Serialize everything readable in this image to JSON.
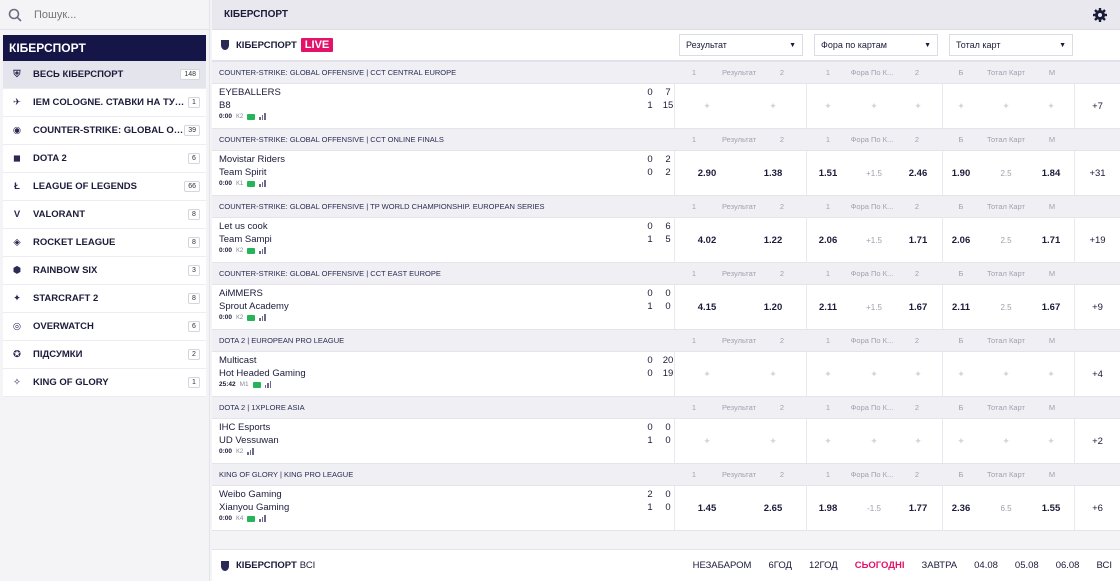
{
  "search": {
    "placeholder": "Пошук..."
  },
  "sidebar": {
    "title": "КІБЕРСПОРТ",
    "items": [
      {
        "label": "ВЕСЬ КІБЕРСПОРТ",
        "count": "148",
        "icon": "esports-icon"
      },
      {
        "label": "IEM COLOGNE. СТАВКИ НА ТУРНІР",
        "count": "1",
        "icon": "iem-icon"
      },
      {
        "label": "COUNTER-STRIKE: GLOBAL OFFENSIVE",
        "count": "39",
        "icon": "csgo-icon"
      },
      {
        "label": "DOTA 2",
        "count": "6",
        "icon": "dota-icon"
      },
      {
        "label": "LEAGUE OF LEGENDS",
        "count": "66",
        "icon": "lol-icon"
      },
      {
        "label": "VALORANT",
        "count": "8",
        "icon": "valorant-icon"
      },
      {
        "label": "ROCKET LEAGUE",
        "count": "8",
        "icon": "rocket-league-icon"
      },
      {
        "label": "RAINBOW SIX",
        "count": "3",
        "icon": "rainbow-six-icon"
      },
      {
        "label": "STARCRAFT 2",
        "count": "8",
        "icon": "starcraft-icon"
      },
      {
        "label": "OVERWATCH",
        "count": "6",
        "icon": "overwatch-icon"
      },
      {
        "label": "ПІДСУМКИ",
        "count": "2",
        "icon": "summary-icon"
      },
      {
        "label": "KING OF GLORY",
        "count": "1",
        "icon": "king-of-glory-icon"
      }
    ]
  },
  "header": {
    "title": "КІБЕРСПОРТ"
  },
  "live": {
    "title": "КІБЕРСПОРТ",
    "badge": "LIVE",
    "dropdowns": [
      "Результат",
      "Фора по картам",
      "Тотал карт"
    ]
  },
  "columns": [
    "1",
    "Результат",
    "2",
    "1",
    "Фора По К...",
    "2",
    "Б",
    "Тотал Карт",
    "М"
  ],
  "leagues": [
    {
      "name": "COUNTER-STRIKE: GLOBAL OFFENSIVE | CCT CENTRAL EUROPE",
      "matches": [
        {
          "team1": "EYEBALLERS",
          "team2": "B8",
          "s1a": "0",
          "s1b": "7",
          "s2a": "1",
          "s2b": "15",
          "time": "0:00",
          "period": "К2",
          "timeBold": true,
          "locked": true,
          "odds": [],
          "more": "+7"
        }
      ]
    },
    {
      "name": "COUNTER-STRIKE: GLOBAL OFFENSIVE | CCT ONLINE FINALS",
      "matches": [
        {
          "team1": "Movistar Riders",
          "team2": "Team Spirit",
          "s1a": "0",
          "s1b": "2",
          "s2a": "0",
          "s2b": "2",
          "time": "0:00",
          "period": "К1",
          "locked": false,
          "odds": [
            "2.90",
            "1.38",
            "1.51",
            "+1.5",
            "2.46",
            "1.90",
            "2.5",
            "1.84"
          ],
          "more": "+31"
        }
      ]
    },
    {
      "name": "COUNTER-STRIKE: GLOBAL OFFENSIVE | TP WORLD CHAMPIONSHIP. EUROPEAN SERIES",
      "matches": [
        {
          "team1": "Let us cook",
          "team2": "Team Sampi",
          "s1a": "0",
          "s1b": "6",
          "s2a": "1",
          "s2b": "5",
          "time": "0:00",
          "period": "К2",
          "locked": false,
          "odds": [
            "4.02",
            "1.22",
            "2.06",
            "+1.5",
            "1.71",
            "2.06",
            "2.5",
            "1.71"
          ],
          "more": "+19"
        }
      ]
    },
    {
      "name": "COUNTER-STRIKE: GLOBAL OFFENSIVE | CCT EAST EUROPE",
      "matches": [
        {
          "team1": "AiMMERS",
          "team2": "Sprout Academy",
          "s1a": "0",
          "s1b": "0",
          "s2a": "1",
          "s2b": "0",
          "time": "0:00",
          "period": "К2",
          "locked": false,
          "odds": [
            "4.15",
            "1.20",
            "2.11",
            "+1.5",
            "1.67",
            "2.11",
            "2.5",
            "1.67"
          ],
          "more": "+9"
        }
      ]
    },
    {
      "name": "DOTA 2 | EUROPEAN PRO LEAGUE",
      "matches": [
        {
          "team1": "Multicast",
          "team2": "Hot Headed Gaming",
          "s1a": "0",
          "s1b": "20",
          "s2a": "0",
          "s2b": "19",
          "time": "25:42",
          "period": "М1",
          "locked": true,
          "odds": [],
          "more": "+4"
        }
      ]
    },
    {
      "name": "DOTA 2 | 1XPLORE ASIA",
      "matches": [
        {
          "team1": "IHC Esports",
          "team2": "UD Vessuwan",
          "s1a": "0",
          "s1b": "0",
          "s2a": "1",
          "s2b": "0",
          "time": "0:00",
          "period": "К2",
          "locked": true,
          "noTv": true,
          "odds": [],
          "more": "+2"
        }
      ]
    },
    {
      "name": "KING OF GLORY | KING PRO LEAGUE",
      "matches": [
        {
          "team1": "Weibo Gaming",
          "team2": "Xianyou Gaming",
          "s1a": "2",
          "s1b": "0",
          "s2a": "1",
          "s2b": "0",
          "time": "0:00",
          "period": "К4",
          "locked": false,
          "odds": [
            "1.45",
            "2.65",
            "1.98",
            "-1.5",
            "1.77",
            "2.36",
            "6.5",
            "1.55"
          ],
          "more": "+6"
        }
      ]
    }
  ],
  "footer": {
    "title": "КІБЕРСПОРТ",
    "subtitle": "ВСІ",
    "periods": [
      "НЕЗАБАРОМ",
      "6ГОД",
      "12ГОД",
      "СЬОГОДНІ",
      "ЗАВТРА",
      "04.08",
      "05.08",
      "06.08",
      "ВСІ"
    ],
    "activePeriod": "СЬОГОДНІ"
  },
  "colors": {
    "accent": "#e3136a",
    "navy": "#151547",
    "tv": "#27b35a"
  }
}
